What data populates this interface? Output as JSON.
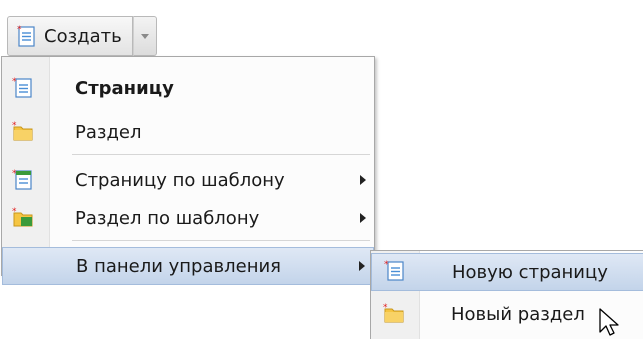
{
  "toolbar": {
    "create_label": "Создать"
  },
  "menu": {
    "items": [
      {
        "label": "Страницу"
      },
      {
        "label": "Раздел"
      },
      {
        "label": "Страницу по шаблону"
      },
      {
        "label": "Раздел по шаблону"
      },
      {
        "label": "В панели управления"
      }
    ]
  },
  "submenu": {
    "items": [
      {
        "label": "Новую страницу"
      },
      {
        "label": "Новый раздел"
      }
    ]
  },
  "colors": {
    "highlight": "#c9d9ee",
    "folder": "#f5c542",
    "page_lines": "#4a8fd6",
    "new_star": "#e02020",
    "template_green": "#3a9a3a"
  }
}
